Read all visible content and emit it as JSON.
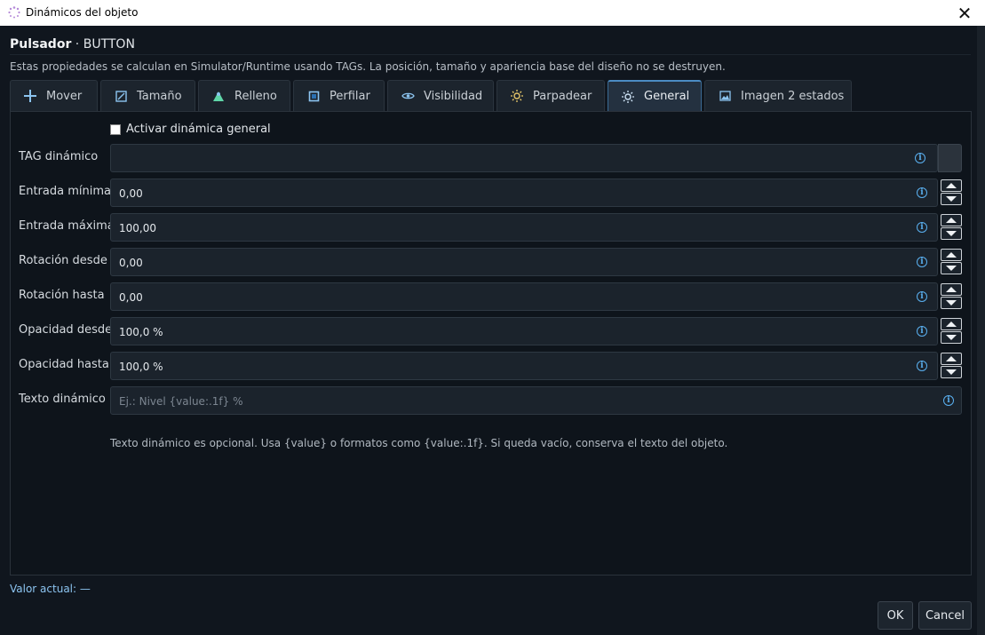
{
  "window": {
    "title": "Dinámicos del objeto",
    "close_glyph": "✕"
  },
  "header": {
    "name": "Pulsador",
    "separator": " · ",
    "type": "BUTTON"
  },
  "description": "Estas propiedades se calculan en Simulator/Runtime usando TAGs. La posición, tamaño y apariencia base del diseño no se destruyen.",
  "tabs": [
    {
      "label": "Mover",
      "icon": "move-icon",
      "active": false
    },
    {
      "label": "Tamaño",
      "icon": "resize-icon",
      "active": false
    },
    {
      "label": "Relleno",
      "icon": "fill-icon",
      "active": false
    },
    {
      "label": "Perfilar",
      "icon": "outline-icon",
      "active": false
    },
    {
      "label": "Visibilidad",
      "icon": "eye-icon",
      "active": false
    },
    {
      "label": "Parpadear",
      "icon": "sun-icon",
      "active": false
    },
    {
      "label": "General",
      "icon": "gear-icon",
      "active": true
    },
    {
      "label": "Imagen 2 estados",
      "icon": "image-icon",
      "active": false
    }
  ],
  "general": {
    "enable_label": "Activar dinámica general",
    "enable_checked": false,
    "tag": {
      "label": "TAG dinámico",
      "value": ""
    },
    "fields": [
      {
        "label": "Entrada mínima",
        "value": "0,00"
      },
      {
        "label": "Entrada máxima",
        "value": "100,00"
      },
      {
        "label": "Rotación desde",
        "value": "0,00"
      },
      {
        "label": "Rotación hasta",
        "value": "0,00"
      },
      {
        "label": "Opacidad desde",
        "value": "100,0 %"
      },
      {
        "label": "Opacidad hasta",
        "value": "100,0 %"
      }
    ],
    "text": {
      "label": "Texto dinámico",
      "value": "",
      "placeholder": "Ej.: Nivel {value:.1f} %"
    },
    "hint": "Texto dinámico es opcional. Usa {value} o formatos como {value:.1f}. Si queda vacío, conserva el texto del objeto."
  },
  "status": "Valor actual: —",
  "buttons": {
    "ok": "OK",
    "cancel": "Cancel"
  },
  "colors": {
    "accent": "#4b8cc4",
    "info": "#5ab0f0",
    "background": "#10161e"
  }
}
